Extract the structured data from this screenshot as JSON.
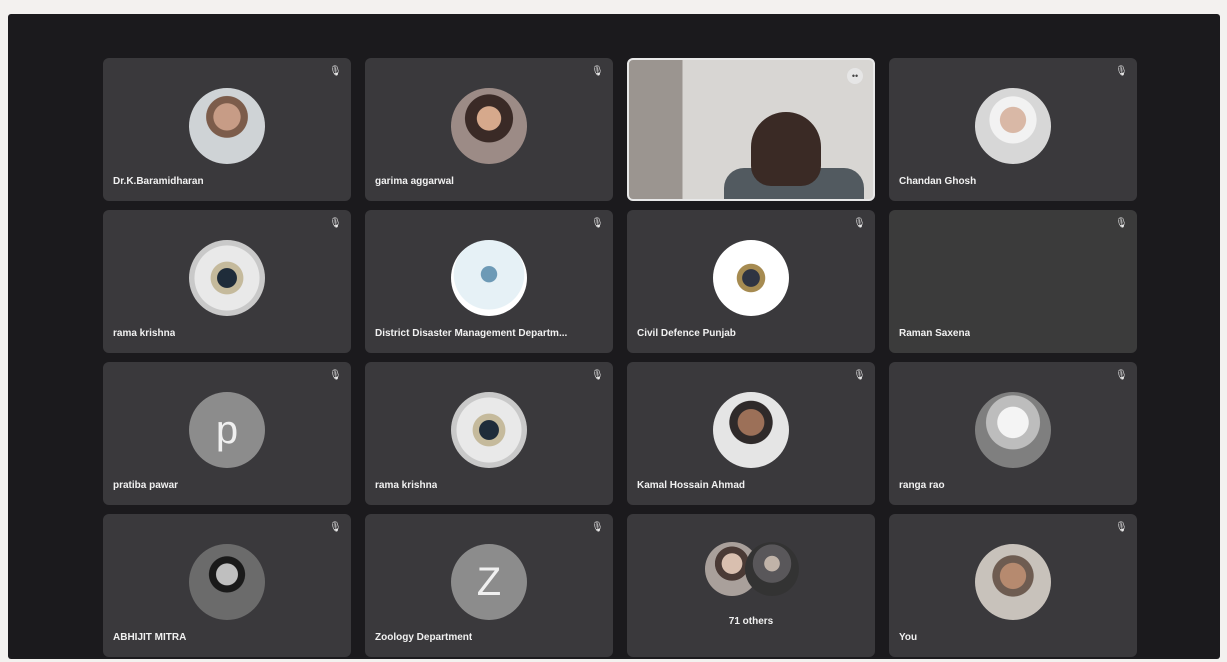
{
  "meeting": {
    "participants": [
      {
        "name": "Dr.K.Baramidharan",
        "avatar": "photo",
        "mic": "muted"
      },
      {
        "name": "garima aggarwal",
        "avatar": "photo",
        "mic": "muted"
      },
      {
        "name": "",
        "avatar": "video",
        "mic": "pinned"
      },
      {
        "name": "Chandan Ghosh",
        "avatar": "photo",
        "mic": "muted"
      },
      {
        "name": "rama krishna",
        "avatar": "emblem",
        "mic": "muted"
      },
      {
        "name": "District Disaster Management Departm...",
        "avatar": "logo",
        "mic": "muted"
      },
      {
        "name": "Civil Defence Punjab",
        "avatar": "emblem",
        "mic": "muted"
      },
      {
        "name": "Raman Saxena",
        "avatar": "blank",
        "mic": "muted"
      },
      {
        "name": "pratiba pawar",
        "avatar": "letter",
        "letter": "p",
        "mic": "muted"
      },
      {
        "name": "rama krishna",
        "avatar": "emblem",
        "mic": "muted"
      },
      {
        "name": "Kamal Hossain Ahmad",
        "avatar": "photo",
        "mic": "muted"
      },
      {
        "name": "ranga rao",
        "avatar": "photo",
        "mic": "muted"
      },
      {
        "name": "ABHIJIT MITRA",
        "avatar": "photo",
        "mic": "muted"
      },
      {
        "name": "Zoology Department",
        "avatar": "letter",
        "letter": "Z",
        "mic": "muted"
      },
      {
        "name": "71 others",
        "avatar": "group",
        "mic": "none"
      },
      {
        "name": "You",
        "avatar": "photo",
        "mic": "muted"
      }
    ],
    "icons": {
      "mic": "mic-muted-icon",
      "pin": "pin-icon"
    },
    "colors": {
      "tile": "#3a393c",
      "background": "#1b1a1d"
    }
  }
}
